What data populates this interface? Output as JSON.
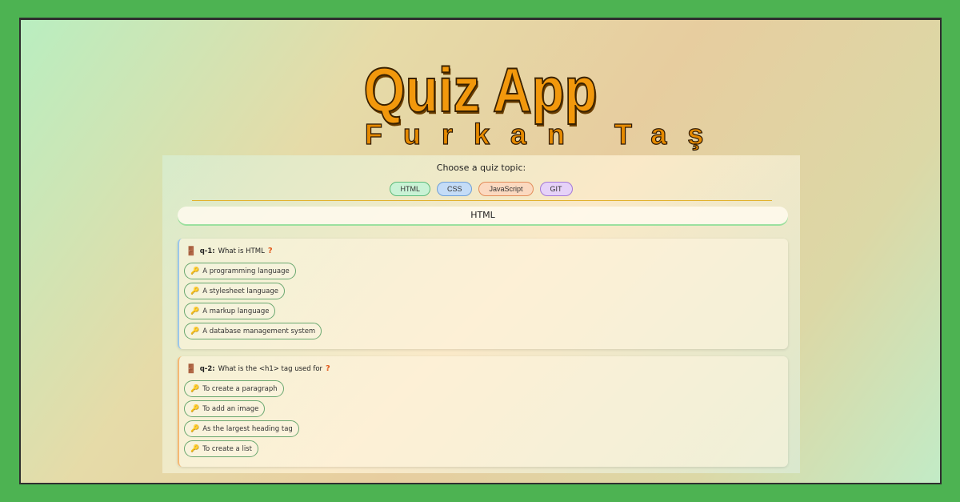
{
  "header": {
    "title": "Quiz App",
    "subtitle": "Furkan Taş"
  },
  "topic_selector": {
    "prompt": "Choose a quiz topic:",
    "topics": [
      {
        "label": "HTML",
        "bg": "#c9f2d5",
        "border": "#5dbb7b"
      },
      {
        "label": "CSS",
        "bg": "#c4dcf7",
        "border": "#6f9fd6"
      },
      {
        "label": "JavaScript",
        "bg": "#fbd9c0",
        "border": "#e38d5a"
      },
      {
        "label": "GIT",
        "bg": "#e6d2f8",
        "border": "#a57ad6"
      }
    ],
    "selected": "HTML"
  },
  "questions": [
    {
      "id": "q-1:",
      "text": "What is HTML",
      "icon": "door-icon",
      "answers": [
        "A programming language",
        "A stylesheet language",
        "A markup language",
        "A database management system"
      ]
    },
    {
      "id": "q-2:",
      "text": "What is the <h1> tag used for",
      "icon": "door-icon",
      "answers": [
        "To create a paragraph",
        "To add an image",
        "As the largest heading tag",
        "To create a list"
      ]
    }
  ]
}
